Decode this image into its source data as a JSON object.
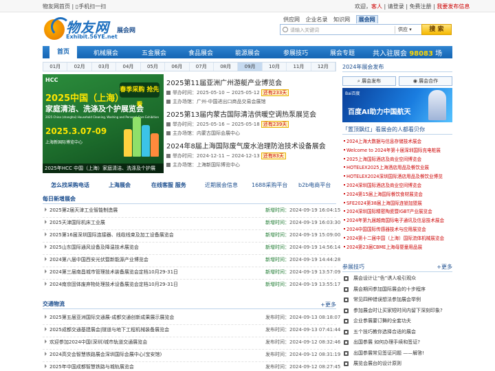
{
  "topbar": {
    "left": [
      "物友网首页",
      "手机扫一扫"
    ],
    "welcome": "欢迎，",
    "guest": "客人",
    "login": "请登录",
    "register": "免费注册",
    "my_publish": "我要发布信息"
  },
  "logo": {
    "main": "物友网",
    "sub": "Exhibit.56YE.net",
    "site": "展会网"
  },
  "search": {
    "tabs": [
      "供应网",
      "企业名录",
      "知识网",
      "展会网"
    ],
    "active_tab": "展会网",
    "placeholder": "请输入关键词",
    "category": "供应",
    "button": "搜 索"
  },
  "nav": {
    "items": [
      "首页",
      "机械展会",
      "五金展会",
      "食品展会",
      "能源展会",
      "参展技巧",
      "展会专题"
    ],
    "join_label": "共入驻展会",
    "join_count": "98083",
    "join_unit": "场"
  },
  "months": {
    "items": [
      "01月",
      "02月",
      "03月",
      "04月",
      "05月",
      "06月",
      "07月",
      "08月",
      "09月",
      "10月",
      "11月",
      "12月"
    ],
    "active": "09月"
  },
  "banner": {
    "hcc": "HCC",
    "title1": "2025中国（上海）",
    "title2": "家庭清洁、洗涤及个护展览会",
    "en": "2025 China (shanghai) Household Cleaning, Washing and Personal Care Exhibition",
    "date": "2025.3.07-09",
    "place": "上海新国际博览中心",
    "badge": "春季采购 抢先看",
    "caption": "2025年HCC 中国（上海）家庭清洁、洗涤及个护展"
  },
  "featured": [
    {
      "title": "2025第11届亚洲广州游艇产业博览会",
      "time": "举办时间：2025-05-10 ~ 2025-05-12",
      "hot": "还有233天",
      "sponsor": "主办场馆：广州-中国进出口商品交易会展馆"
    },
    {
      "title": "2025第13届内蒙古国际清洁供暖空调热泵展览会",
      "time": "举办时间：2025-05-16 ~ 2025-05-18",
      "hot": "还有239天",
      "sponsor": "主办场馆：内蒙古国际会展中心"
    },
    {
      "title": "2024年8届上海国际废气废水治理防治技术设备展会",
      "time": "举办时间：2024-12-11 ~ 2024-12-13",
      "hot": "还有83天",
      "sponsor": "主办场馆：上海新国际博览中心"
    }
  ],
  "linkbar": [
    "怎么找采购电话",
    "上海展会",
    "在线客服 服务",
    "近期展会信息",
    "1688采购平台",
    "b2b电商平台"
  ],
  "latest": {
    "title": "每日新增展会",
    "date_prefix": "新增时间：",
    "rows": [
      {
        "t": "2025第2届天津工业智能制造展",
        "d": "2024-09-19 16:04:15"
      },
      {
        "t": "2025天津国际机床工业展",
        "d": "2024-09-19 16:03:30"
      },
      {
        "t": "2025第16届深圳国际连接器、线缆线束及加工设备展览会",
        "d": "2024-09-19 15:09:00"
      },
      {
        "t": "2025山东国际通风设备及降温技术展览会",
        "d": "2024-09-19 14:56:14"
      },
      {
        "t": "2024第八届中国西安光伏暨新能源产业博览会",
        "d": "2024-09-19 14:44:28"
      },
      {
        "t": "2024第三届南昌城市管理技术装备展览会定档10月29-31日",
        "d": "2024-09-19 13:57:09"
      },
      {
        "t": "2024南京固体废弃物处理技术设备展览会定档10月29-31日",
        "d": "2024-09-19 13:55:17"
      }
    ]
  },
  "traffic": {
    "title": "交通物流",
    "more": "+更多",
    "date_prefix": "发布时间：",
    "rows": [
      {
        "t": "2025第五届亚洲国际交通展-成都交通创新成果展示展览会",
        "d": "2024-09-13 08:18:07"
      },
      {
        "t": "2025成都交通基建展会|隧道与地下工程机械装备展览会",
        "d": "2024-09-13 07:41:44"
      },
      {
        "t": "欢迎参加2024中国(深圳)城市轨道交通展览会",
        "d": "2024-09-12 08:32:46"
      },
      {
        "t": "2024高交会智慧铁路展会深圳国际会展中心(宝安馆)",
        "d": "2024-09-12 08:31:19"
      },
      {
        "t": "2025年中国成都智慧铁路与城轨展览会",
        "d": "2024-09-12 08:27:45"
      }
    ]
  },
  "right": {
    "pub_title": "2024年展会发布",
    "tabs": [
      "展会发布",
      "展会合作"
    ],
    "ad_small": "Bai百度",
    "ad_text": "百度AI助力中国航天",
    "hot_title": "「置顶飘红」看展会的人都看贝你",
    "hot": [
      "2024上海大数据与信息存储技术展会",
      "Welcome to 2024年第十届深圳国际充电桩展",
      "2025上海国际酒店及商业空间博览会",
      "HOTELEX2025上海酒店用品及餐饮业展",
      "HOTELEX2024深圳国际酒店用品及餐饮业博览",
      "2024深圳国际酒店及商业空间博览会",
      "2024第15届上海国际餐饮食材展览会",
      "SFE2024第38届上海国际连锁加盟展",
      "2024深圳国际精密陶瓷暨IGBT产业展览会",
      "2024年第九届越南国际电子通讯及信息技术展会",
      "2024中国国际传感器技术与应用展览会",
      "2024第十二届中国（上海）国际流体机械展览会",
      "2024第23届CBME上海母婴童用品展"
    ],
    "tips_title": "参展技巧",
    "tips_more": "+更多",
    "tips": [
      "展会设计让“色”诱人吸引观众",
      "展会期间参加国际展会的十步程序",
      "常见四种错误想法参加展会举例",
      "参加展会时让买家短时间内留下深刻印象?",
      "企业参展要订舞的全套功夫",
      "五个技巧教你选择合适的展会",
      "出国参展 如何办理手续和签证?",
      "出国参展常见签证问题 ——解答!",
      "展览会展台的设计原则"
    ]
  }
}
